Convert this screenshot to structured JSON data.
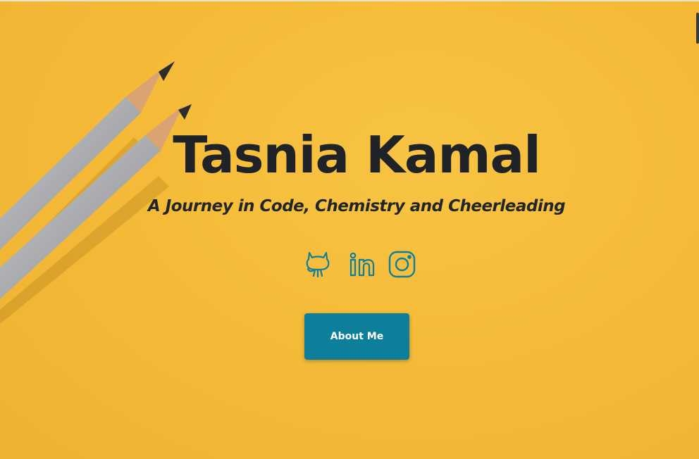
{
  "hero": {
    "title": "Tasnia Kamal",
    "subtitle": "A Journey in Code, Chemistry and Cheerleading",
    "background_color": "#f6bd3a"
  },
  "social_links": [
    {
      "icon": "github-icon"
    },
    {
      "icon": "linkedin-icon"
    },
    {
      "icon": "instagram-icon"
    }
  ],
  "social_icon_color": "#0e7f9a",
  "about_button": {
    "label": "About Me",
    "color": "#0e7f9a"
  }
}
